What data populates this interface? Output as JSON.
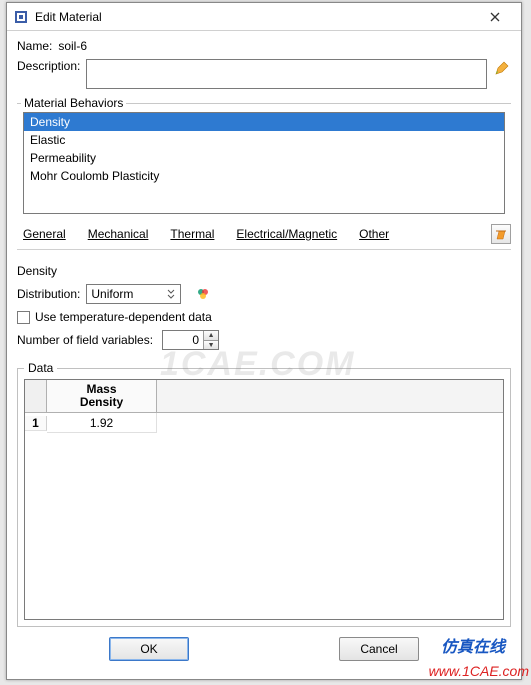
{
  "window": {
    "title": "Edit Material"
  },
  "fields": {
    "name_label": "Name:",
    "name_value": "soil-6",
    "description_label": "Description:",
    "description_value": ""
  },
  "behaviors": {
    "title": "Material Behaviors",
    "items": [
      "Density",
      "Elastic",
      "Permeability",
      "Mohr Coulomb Plasticity"
    ],
    "selected_index": 0
  },
  "tabs": {
    "general": "General",
    "mechanical": "Mechanical",
    "thermal": "Thermal",
    "electrical": "Electrical/Magnetic",
    "other": "Other"
  },
  "density": {
    "title": "Density",
    "distribution_label": "Distribution:",
    "distribution_value": "Uniform",
    "temp_dep_label": "Use temperature-dependent data",
    "nfv_label": "Number of field variables:",
    "nfv_value": "0",
    "data_header": "Data",
    "col1_l1": "Mass",
    "col1_l2": "Density",
    "row1_idx": "1",
    "row1_val": "1.92"
  },
  "buttons": {
    "ok": "OK",
    "cancel": "Cancel"
  },
  "watermarks": {
    "center": "1CAE.COM",
    "blue": "仿真在线",
    "red": "www.1CAE.com"
  }
}
